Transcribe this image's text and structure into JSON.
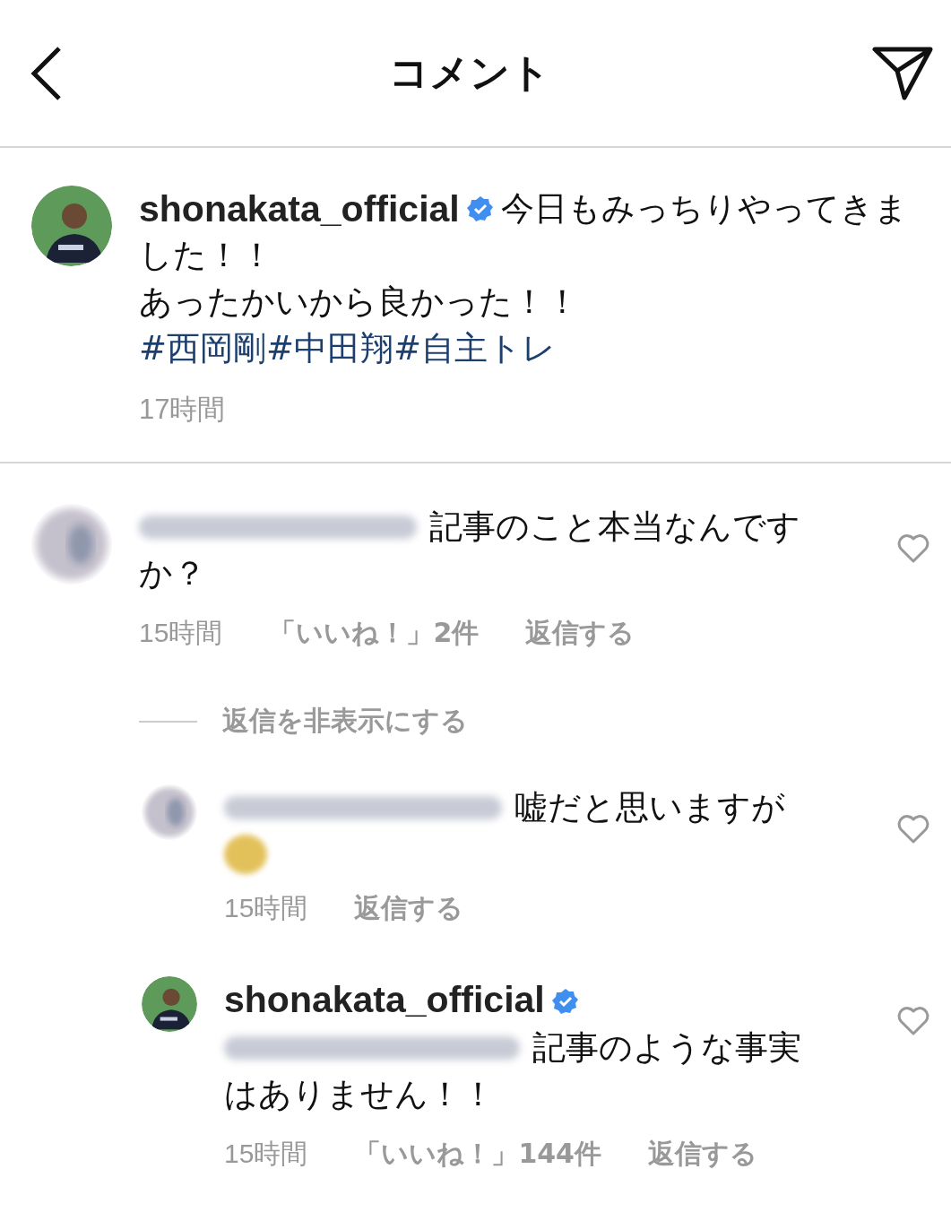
{
  "header": {
    "title": "コメント"
  },
  "caption": {
    "author": {
      "name": "shonakata_official",
      "verified": true
    },
    "lines": [
      "今日もみっちりやってきま",
      "した！！",
      "あったかいから良かった！！"
    ],
    "hashtags": [
      "#西岡剛",
      "#中田翔",
      "#自主トレ"
    ],
    "time": "17時間"
  },
  "comments": [
    {
      "kind": "comment",
      "lines": [
        "記事のこと本当なんです",
        "か？"
      ],
      "time": "15時間",
      "likes": "「いいね！」2件",
      "reply": "返信する",
      "hide_replies": "返信を非表示にする"
    },
    {
      "kind": "reply",
      "lines": [
        "嘘だと思いますが"
      ],
      "emoji_blurred": true,
      "time": "15時間",
      "reply": "返信する"
    },
    {
      "kind": "reply",
      "author": {
        "name": "shonakata_official",
        "verified": true
      },
      "mention_blurred": true,
      "lines": [
        "記事のような事実",
        "はありません！！"
      ],
      "time": "15時間",
      "likes": "「いいね！」144件",
      "reply": "返信する"
    }
  ]
}
